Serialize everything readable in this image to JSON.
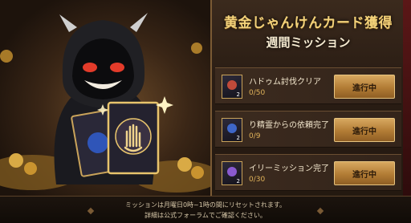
{
  "header": {
    "title": "黄金じゃんけんカード獲得",
    "subtitle": "週間ミッション"
  },
  "missions": [
    {
      "label": "ハドゥム討伐クリア",
      "progress": "0/50",
      "count": "2",
      "button": "進行中",
      "orb_color": "#c14a3a"
    },
    {
      "label": "り精霊からの依頼完了",
      "progress": "0/9",
      "count": "2",
      "button": "進行中",
      "orb_color": "#3e66c8"
    },
    {
      "label": "イリーミッション完了",
      "progress": "0/30",
      "count": "2",
      "button": "進行中",
      "orb_color": "#8a5ad0"
    }
  ],
  "footer": {
    "line1": "ミッションは月曜日0時~1時の間にリセットされます。",
    "line2": "詳細は公式フォーラムでご確認ください。"
  },
  "colors": {
    "accent": "#f3d27a",
    "button": "#b27c35"
  },
  "icons": {
    "card": "rock-paper-scissors-card-icon",
    "hand": "open-palm-icon"
  }
}
